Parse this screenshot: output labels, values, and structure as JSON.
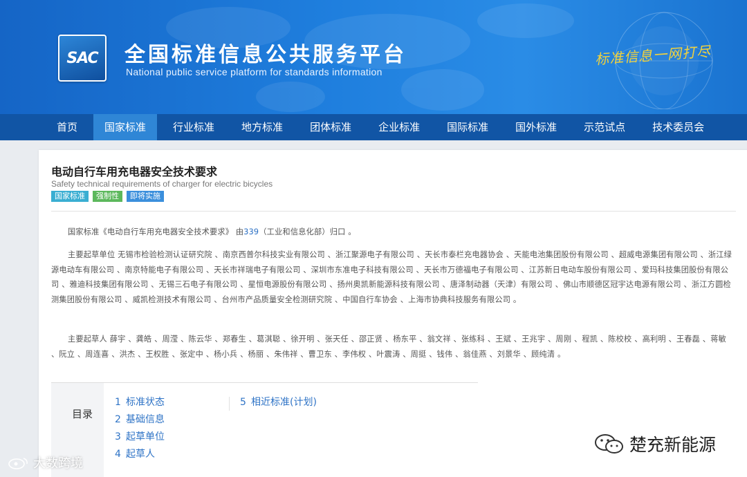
{
  "header": {
    "logo_text": "SAC",
    "site_title": "全国标准信息公共服务平台",
    "site_subtitle": "National public service platform  for standards information",
    "slogan": "标准信息一网打尽"
  },
  "nav": {
    "items": [
      {
        "label": "首页",
        "active": false
      },
      {
        "label": "国家标准",
        "active": true
      },
      {
        "label": "行业标准",
        "active": false
      },
      {
        "label": "地方标准",
        "active": false
      },
      {
        "label": "团体标准",
        "active": false
      },
      {
        "label": "企业标准",
        "active": false
      },
      {
        "label": "国际标准",
        "active": false
      },
      {
        "label": "国外标准",
        "active": false
      },
      {
        "label": "示范试点",
        "active": false
      },
      {
        "label": "技术委员会",
        "active": false
      }
    ]
  },
  "standard": {
    "title": "电动自行车用充电器安全技术要求",
    "subtitle": "Safety technical requirements of charger for electric bicycles",
    "badges": [
      "国家标准",
      "强制性",
      "即将实施"
    ],
    "intro_prefix": "国家标准《电动自行车用充电器安全技术要求》 由",
    "intro_link": "339",
    "intro_suffix": "（工业和信息化部）归口 。",
    "drafting_units": "主要起草单位 无锡市检验检测认证研究院 、南京西普尔科技实业有限公司 、浙江聚源电子有限公司 、天长市泰栏充电器协会 、天能电池集团股份有限公司 、超威电源集团有限公司 、浙江绿源电动车有限公司 、南京特能电子有限公司 、天长市祥瑞电子有限公司 、深圳市东准电子科技有限公司 、天长市万德福电子有限公司 、江苏新日电动车股份有限公司 、爱玛科技集团股份有限公司 、雅迪科技集团有限公司 、无锡三石电子有限公司 、星恒电源股份有限公司 、扬州奥凯新能源科技有限公司 、唐泽制动器（天津）有限公司 、佛山市顺德区冠宇达电源有限公司 、浙江方圆检测集团股份有限公司 、威凯检测技术有限公司 、台州市产品质量安全检测研究院 、中国自行车协会 、上海市协典科技服务有限公司 。",
    "drafters": "主要起草人 薛宇 、龚皓 、周滢 、陈云华 、郑春生 、葛淇聪 、徐开明 、张天任 、邵正贤 、杨东平 、翁文祥 、张练科 、王斌 、王兆宇 、周刚 、程凯 、陈校校 、高利明 、王春磊 、蒋敏 、阮立 、周连喜 、洪杰 、王权胜 、张定中 、杨小兵 、杨丽 、朱伟祥 、曹卫东 、李伟权 、叶震涛 、周挺 、钱伟 、翁佳燕 、刘景华 、顾纯清 。"
  },
  "toc": {
    "label": "目录",
    "col1": [
      {
        "num": "1",
        "label": "标准状态"
      },
      {
        "num": "2",
        "label": "基础信息"
      },
      {
        "num": "3",
        "label": "起草单位"
      },
      {
        "num": "4",
        "label": "起草人"
      }
    ],
    "col2": [
      {
        "num": "5",
        "label": "相近标准(计划)"
      }
    ]
  },
  "watermarks": {
    "left": "大数跨境",
    "right": "楚充新能源"
  },
  "colors": {
    "banner_blue": "#1f7fde",
    "nav_blue": "#1155a5",
    "nav_active": "#2f86d6",
    "link_blue": "#2e73c6",
    "slogan_gold": "#f2d23c"
  }
}
